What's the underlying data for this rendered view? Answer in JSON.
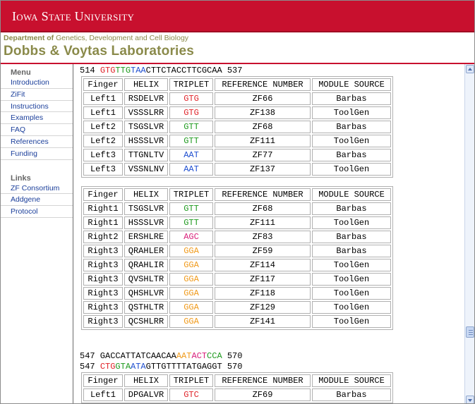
{
  "university": "Iowa State University",
  "department": {
    "bold": "Department of",
    "rest": " Genetics, Development and Cell Biology"
  },
  "lab_title": "Dobbs & Voytas Laboratories",
  "sidebar": {
    "menu_heading": "Menu",
    "menu_items": [
      "Introduction",
      "ZiFit",
      "Instructions",
      "Examples",
      "FAQ",
      "References",
      "Funding"
    ],
    "links_heading": "Links",
    "link_items": [
      "ZF Consortium",
      "Addgene",
      "Protocol"
    ]
  },
  "colors": {
    "red": "#e0242a",
    "green": "#1f9a1f",
    "blue": "#1f4fd0",
    "magenta": "#d8207a",
    "orange": "#f09a1a",
    "black": "#000000"
  },
  "sections": [
    {
      "lines": [
        [
          [
            "514 ",
            "black"
          ],
          [
            "GTG",
            "red"
          ],
          [
            "TTG",
            "green"
          ],
          [
            "TAA",
            "blue"
          ],
          [
            "CTTCTACCTTCGCAA 537",
            "black"
          ]
        ]
      ],
      "header": [
        "Finger",
        "HELIX",
        "TRIPLET",
        "REFERENCE NUMBER",
        "MODULE SOURCE"
      ],
      "rows": [
        [
          "Left1",
          "RSDELVR",
          "GTG",
          "red",
          "ZF66",
          "Barbas"
        ],
        [
          "Left1",
          "VSSSLRR",
          "GTG",
          "red",
          "ZF138",
          "ToolGen"
        ],
        [
          "Left2",
          "TSGSLVR",
          "GTT",
          "green",
          "ZF68",
          "Barbas"
        ],
        [
          "Left2",
          "HSSSLVR",
          "GTT",
          "green",
          "ZF111",
          "ToolGen"
        ],
        [
          "Left3",
          "TTGNLTV",
          "AAT",
          "blue",
          "ZF77",
          "Barbas"
        ],
        [
          "Left3",
          "VSSNLNV",
          "AAT",
          "blue",
          "ZF137",
          "ToolGen"
        ]
      ]
    },
    {
      "lines": [],
      "header": [
        "Finger",
        "HELIX",
        "TRIPLET",
        "REFERENCE NUMBER",
        "MODULE SOURCE"
      ],
      "rows": [
        [
          "Right1",
          "TSGSLVR",
          "GTT",
          "green",
          "ZF68",
          "Barbas"
        ],
        [
          "Right1",
          "HSSSLVR",
          "GTT",
          "green",
          "ZF111",
          "ToolGen"
        ],
        [
          "Right2",
          "ERSHLRE",
          "AGC",
          "magenta",
          "ZF83",
          "Barbas"
        ],
        [
          "Right3",
          "QRAHLER",
          "GGA",
          "orange",
          "ZF59",
          "Barbas"
        ],
        [
          "Right3",
          "QRAHLIR",
          "GGA",
          "orange",
          "ZF114",
          "ToolGen"
        ],
        [
          "Right3",
          "QVSHLTR",
          "GGA",
          "orange",
          "ZF117",
          "ToolGen"
        ],
        [
          "Right3",
          "QHSHLVR",
          "GGA",
          "orange",
          "ZF118",
          "ToolGen"
        ],
        [
          "Right3",
          "QSTHLTR",
          "GGA",
          "orange",
          "ZF129",
          "ToolGen"
        ],
        [
          "Right3",
          "QCSHLRR",
          "GGA",
          "orange",
          "ZF141",
          "ToolGen"
        ]
      ]
    },
    {
      "lines": [
        [
          [
            "547 GACCATTATCAACAA",
            "black"
          ],
          [
            "AAT",
            "orange"
          ],
          [
            "ACT",
            "magenta"
          ],
          [
            "CCA",
            "green"
          ],
          [
            " 570",
            "black"
          ]
        ],
        [
          [
            "547 ",
            "black"
          ],
          [
            "CTG",
            "red"
          ],
          [
            "GTA",
            "green"
          ],
          [
            "ATA",
            "blue"
          ],
          [
            "GTTGTTTTATGAGGT 570",
            "black"
          ]
        ]
      ],
      "header": [
        "Finger",
        "HELIX",
        "TRIPLET",
        "REFERENCE NUMBER",
        "MODULE SOURCE"
      ],
      "rows": [
        [
          "Left1",
          "DPGALVR",
          "GTC",
          "red",
          "ZF69",
          "Barbas"
        ]
      ]
    }
  ]
}
